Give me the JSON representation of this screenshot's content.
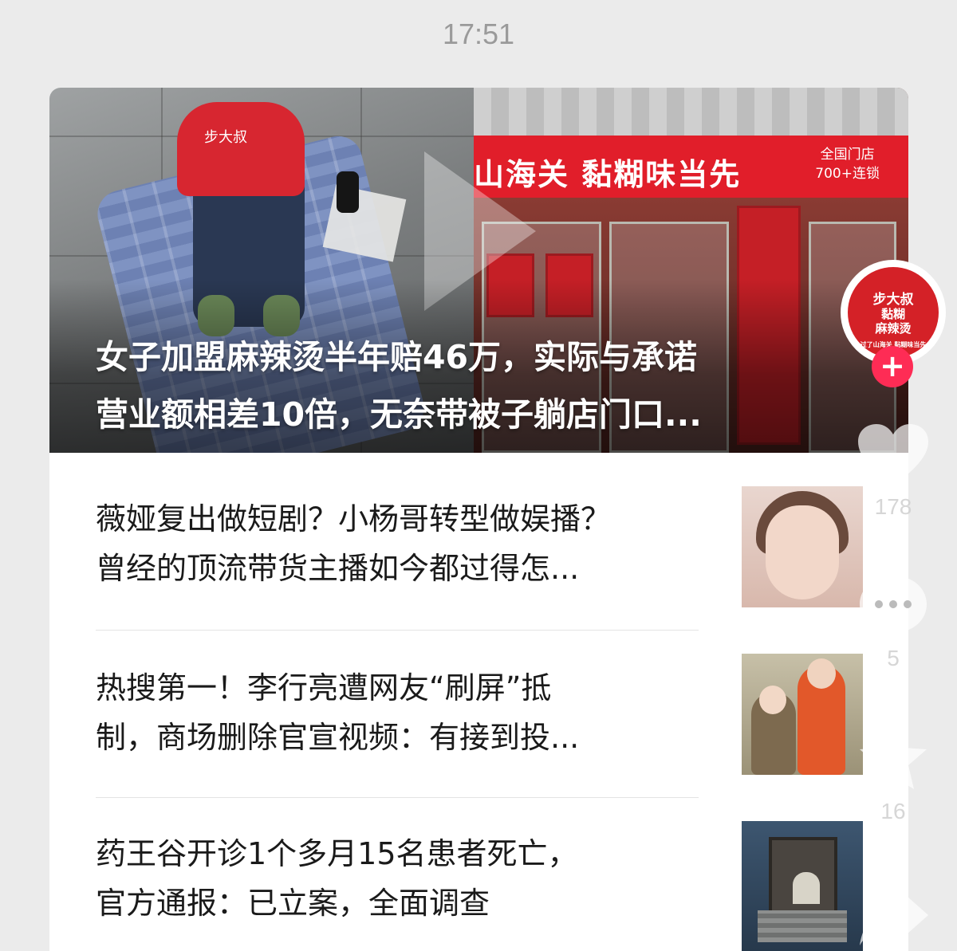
{
  "status": {
    "time": "17:51"
  },
  "hero": {
    "vest_text": "步大叔",
    "sign_main": "山海关  黏糊味当先",
    "sign_sub_1": "全国门店",
    "sign_sub_2": "700+连锁",
    "title_line_1": "女子加盟麻辣烫半年赔46万，实际与承诺",
    "title_line_2": "营业额相差10倍，无奈带被子躺店门口..."
  },
  "news": [
    {
      "line_1": "薇娅复出做短剧？小杨哥转型做娱播？",
      "line_2": "曾经的顶流带货主播如今都过得怎..."
    },
    {
      "line_1": "热搜第一！李行亮遭网友“刷屏”抵",
      "line_2": "制，商场删除官宣视频：有接到投..."
    },
    {
      "line_1": "药王谷开诊1个多月15名患者死亡，",
      "line_2": "官方通报：已立案，全面调查"
    }
  ],
  "side_bar": {
    "avatar_text_1": "步大叔",
    "avatar_text_2": "黏糊",
    "avatar_text_3": "麻辣烫",
    "avatar_caption": "过了山海关 黏糊味当先",
    "follow_symbol": "+",
    "like_count": "178",
    "comment_count": "5",
    "favorite_count": "16",
    "icons": [
      "heart-icon",
      "comment-icon",
      "star-icon",
      "share-icon"
    ]
  },
  "colors": {
    "follow": "#fe2c55",
    "brand_red": "#e11e2a"
  }
}
